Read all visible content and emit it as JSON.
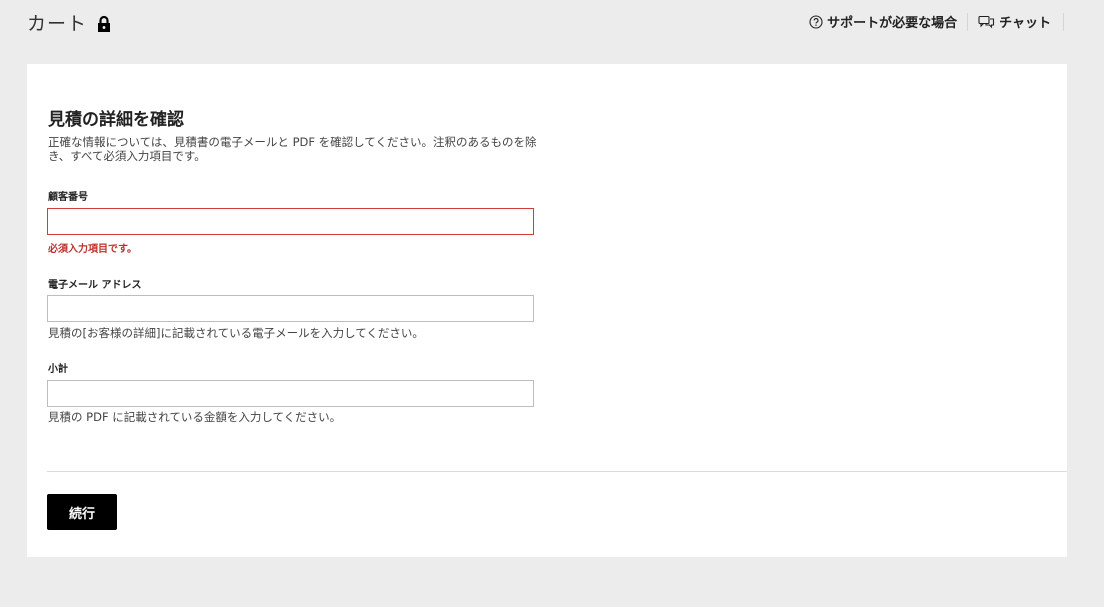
{
  "header": {
    "title": "カート",
    "lock_icon": "lock-icon",
    "support_label": "サポートが必要な場合",
    "support_icon": "help-circle-icon",
    "chat_label": "チャット",
    "chat_icon": "chat-bubbles-icon"
  },
  "form": {
    "heading": "見積の詳細を確認",
    "description": "正確な情報については、見積書の電子メールと PDF を確認してください。注釈のあるものを除き、すべて必須入力項目です。",
    "fields": [
      {
        "label": "顧客番号",
        "value": "",
        "error": "必須入力項目です。",
        "state": "error"
      },
      {
        "label": "電子メール アドレス",
        "value": "",
        "help": "見積の[お客様の詳細]に記載されている電子メールを入力してください。"
      },
      {
        "label": "小計",
        "value": "",
        "help": "見積の PDF に記載されている金額を入力してください。"
      }
    ],
    "continue_label": "続行"
  },
  "colors": {
    "accent": "#000000",
    "error": "#c0302a",
    "background": "#ececec"
  }
}
